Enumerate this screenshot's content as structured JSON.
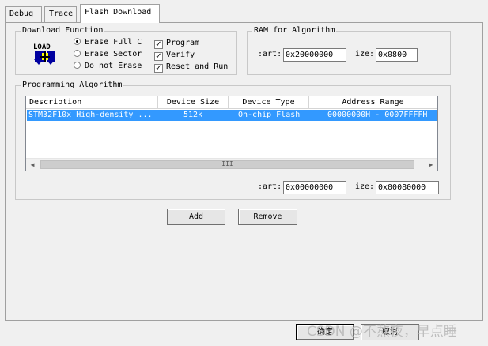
{
  "tabs": [
    {
      "label": "Debug"
    },
    {
      "label": "Trace"
    },
    {
      "label": "Flash Download"
    }
  ],
  "download_function": {
    "title": "Download Function",
    "icon_label": "LOAD",
    "erase_options": [
      {
        "label": "Erase Full C",
        "selected": true
      },
      {
        "label": "Erase Sector",
        "selected": false
      },
      {
        "label": "Do not Erase",
        "selected": false
      }
    ],
    "checks": [
      {
        "label": "Program",
        "checked": true
      },
      {
        "label": "Verify",
        "checked": true
      },
      {
        "label": "Reset and Run",
        "checked": true
      }
    ],
    "check_mark": "✓"
  },
  "ram": {
    "title": "RAM for Algorithm",
    "start_label": ":art:",
    "start_value": "0x20000000",
    "size_label": "ize:",
    "size_value": "0x0800"
  },
  "programming": {
    "title": "Programming Algorithm",
    "columns": [
      "Description",
      "Device Size",
      "Device Type",
      "Address Range"
    ],
    "rows": [
      {
        "description": "STM32F10x High-density ...",
        "size": "512k",
        "type": "On-chip Flash",
        "range": "00000000H - 0007FFFFH"
      }
    ],
    "scroll_left": "◀",
    "scroll_right": "▶",
    "scroll_grip": "III",
    "start_label": ":art:",
    "start_value": "0x00000000",
    "size_label": "ize:",
    "size_value": "0x00080000"
  },
  "buttons": {
    "add": "Add",
    "remove": "Remove",
    "ok": "确定",
    "cancel": "取消"
  },
  "watermark": "CSDN @不熬夜，早点睡"
}
